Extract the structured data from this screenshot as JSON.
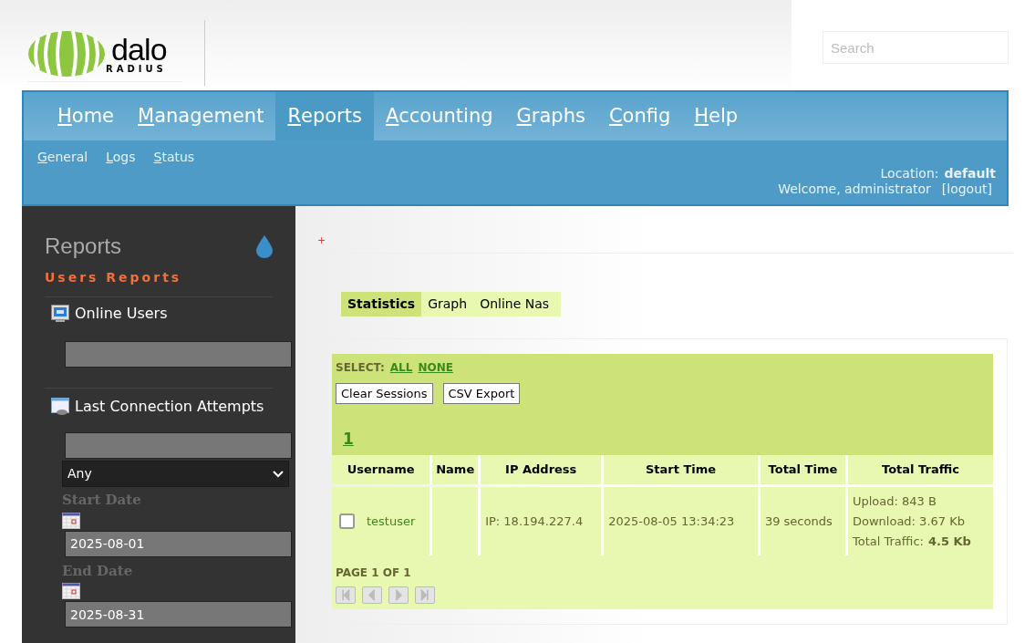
{
  "logo": {
    "name": "dalo",
    "sub": "RADIUS"
  },
  "search": {
    "placeholder": "Search"
  },
  "nav": [
    {
      "label": "Home",
      "selected": false
    },
    {
      "label": "Management",
      "selected": false
    },
    {
      "label": "Reports",
      "selected": true
    },
    {
      "label": "Accounting",
      "selected": false
    },
    {
      "label": "Graphs",
      "selected": false
    },
    {
      "label": "Config",
      "selected": false
    },
    {
      "label": "Help",
      "selected": false
    }
  ],
  "subnav": [
    "General",
    "Logs",
    "Status"
  ],
  "user_info": {
    "location_label": "Location:",
    "location": "default",
    "welcome": "Welcome, administrator",
    "logout": "[logout]"
  },
  "sidebar": {
    "title": "Reports",
    "section": "Users Reports",
    "online_users": {
      "label": "Online Users"
    },
    "last_connection": {
      "label": "Last Connection Attempts",
      "select": "Any",
      "start_label": "Start Date",
      "start": "2025-08-01",
      "end_label": "End Date",
      "end": "2025-08-31"
    }
  },
  "content": {
    "marker": "+",
    "tabs": [
      {
        "label": "Statistics",
        "selected": true
      },
      {
        "label": "Graph",
        "selected": false
      },
      {
        "label": "Online Nas",
        "selected": false
      }
    ],
    "select_label": "SELECT:",
    "select_all": "ALL",
    "select_none": "NONE",
    "buttons": [
      "Clear Sessions",
      "CSV Export"
    ],
    "page_link": "1",
    "table": {
      "columns": [
        "Username",
        "Name",
        "IP Address",
        "Start Time",
        "Total Time",
        "Total Traffic"
      ],
      "rows": [
        {
          "checked": false,
          "username": "testuser",
          "ip": "IP: 18.194.227.4",
          "start": "2025-08-05 13:34:23",
          "total_time": "39 seconds",
          "upload": "Upload: 843 B",
          "download": "Download: 3.67 Kb",
          "total_label": "Total Traffic:",
          "total": "4.5 Kb"
        }
      ]
    },
    "page_info": "PAGE 1 OF 1"
  }
}
